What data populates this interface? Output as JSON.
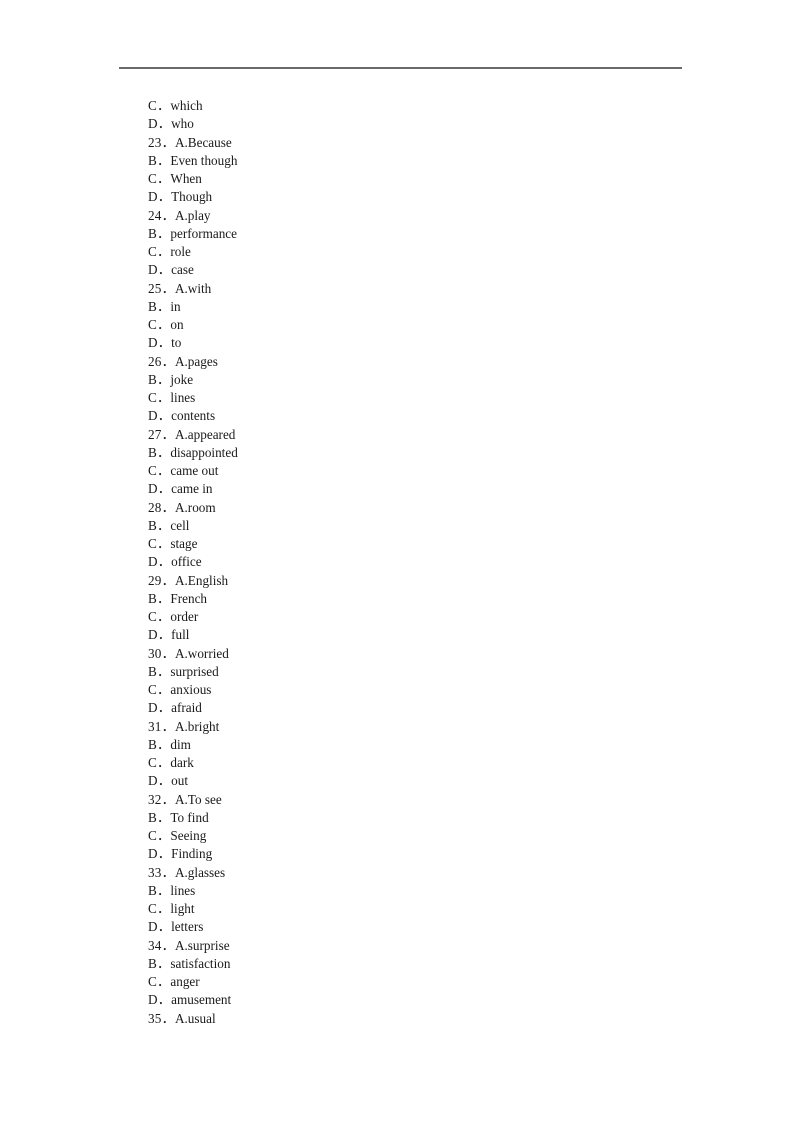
{
  "document": {
    "type": "exam-answer-options",
    "page_background": "#ffffff",
    "text_color": "#1a1a1a",
    "rule_color": "#6a6a6a",
    "header_rule": true
  },
  "lines": [
    {
      "label": "C．",
      "text": "which",
      "kind": "option"
    },
    {
      "label": "D．",
      "text": "who",
      "kind": "option"
    },
    {
      "label": "23．",
      "text": "A.Because",
      "kind": "stem"
    },
    {
      "label": "B．",
      "text": "Even though",
      "kind": "option"
    },
    {
      "label": "C．",
      "text": "When",
      "kind": "option"
    },
    {
      "label": "D．",
      "text": "Though",
      "kind": "option"
    },
    {
      "label": "24．",
      "text": "A.play",
      "kind": "stem"
    },
    {
      "label": "B．",
      "text": "performance",
      "kind": "option"
    },
    {
      "label": "C．",
      "text": "role",
      "kind": "option"
    },
    {
      "label": "D．",
      "text": "case",
      "kind": "option"
    },
    {
      "label": "25．",
      "text": "A.with",
      "kind": "stem"
    },
    {
      "label": "B．",
      "text": "in",
      "kind": "option"
    },
    {
      "label": "C．",
      "text": "on",
      "kind": "option"
    },
    {
      "label": "D．",
      "text": "to",
      "kind": "option"
    },
    {
      "label": "26．",
      "text": "A.pages",
      "kind": "stem"
    },
    {
      "label": "B．",
      "text": "joke",
      "kind": "option"
    },
    {
      "label": "C．",
      "text": "lines",
      "kind": "option"
    },
    {
      "label": "D．",
      "text": "contents",
      "kind": "option"
    },
    {
      "label": "27．",
      "text": "A.appeared",
      "kind": "stem"
    },
    {
      "label": "B．",
      "text": "disappointed",
      "kind": "option"
    },
    {
      "label": "C．",
      "text": "came out",
      "kind": "option"
    },
    {
      "label": "D．",
      "text": "came in",
      "kind": "option"
    },
    {
      "label": "28．",
      "text": "A.room",
      "kind": "stem"
    },
    {
      "label": "B．",
      "text": "cell",
      "kind": "option"
    },
    {
      "label": "C．",
      "text": "stage",
      "kind": "option"
    },
    {
      "label": "D．",
      "text": "office",
      "kind": "option"
    },
    {
      "label": "29．",
      "text": "A.English",
      "kind": "stem"
    },
    {
      "label": "B．",
      "text": "French",
      "kind": "option"
    },
    {
      "label": "C．",
      "text": "order",
      "kind": "option"
    },
    {
      "label": "D．",
      "text": "full",
      "kind": "option"
    },
    {
      "label": "30．",
      "text": "A.worried",
      "kind": "stem"
    },
    {
      "label": "B．",
      "text": "surprised",
      "kind": "option"
    },
    {
      "label": "C．",
      "text": "anxious",
      "kind": "option"
    },
    {
      "label": "D．",
      "text": "afraid",
      "kind": "option"
    },
    {
      "label": "31．",
      "text": "A.bright",
      "kind": "stem"
    },
    {
      "label": "B．",
      "text": "dim",
      "kind": "option"
    },
    {
      "label": "C．",
      "text": "dark",
      "kind": "option"
    },
    {
      "label": "D．",
      "text": "out",
      "kind": "option"
    },
    {
      "label": "32．",
      "text": "A.To see",
      "kind": "stem"
    },
    {
      "label": "B．",
      "text": "To find",
      "kind": "option"
    },
    {
      "label": "C．",
      "text": "Seeing",
      "kind": "option"
    },
    {
      "label": "D．",
      "text": "Finding",
      "kind": "option"
    },
    {
      "label": "33．",
      "text": "A.glasses",
      "kind": "stem"
    },
    {
      "label": "B．",
      "text": "lines",
      "kind": "option"
    },
    {
      "label": "C．",
      "text": "light",
      "kind": "option"
    },
    {
      "label": "D．",
      "text": "letters",
      "kind": "option"
    },
    {
      "label": "34．",
      "text": "A.surprise",
      "kind": "stem"
    },
    {
      "label": "B．",
      "text": "satisfaction",
      "kind": "option"
    },
    {
      "label": "C．",
      "text": "anger",
      "kind": "option"
    },
    {
      "label": "D．",
      "text": "amusement",
      "kind": "option"
    },
    {
      "label": "35．",
      "text": "A.usual",
      "kind": "stem"
    }
  ]
}
